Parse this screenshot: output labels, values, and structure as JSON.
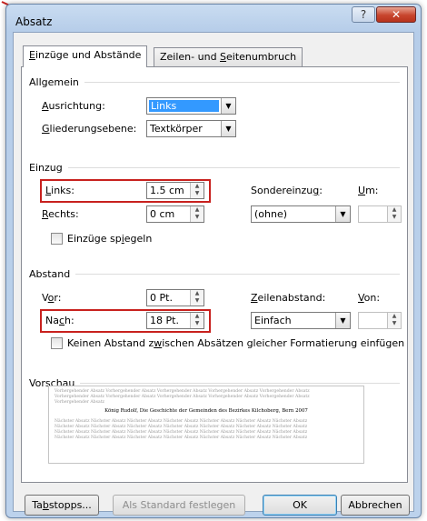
{
  "window": {
    "title": "Absatz",
    "help_label": "?",
    "close_label": "✕"
  },
  "tabs": [
    {
      "label_pre": "",
      "label_u": "E",
      "label_post": "inzüge und Abstände"
    },
    {
      "label_pre": "Zeilen- und ",
      "label_u": "S",
      "label_post": "eitenumbruch"
    }
  ],
  "general": {
    "title": "Allgemein",
    "alignment_label_u": "A",
    "alignment_label_rest": "usrichtung:",
    "alignment_value": "Links",
    "outline_label_u": "G",
    "outline_label_rest": "liederungsebene:",
    "outline_value": "Textkörper"
  },
  "indent": {
    "title": "Einzug",
    "left_label_u": "L",
    "left_label_rest": "inks:",
    "left_value": "1.5 cm",
    "right_label_u": "R",
    "right_label_rest": "echts:",
    "right_value": "0 cm",
    "special_label_pre": "Sondereinzu",
    "special_label_u": "g",
    "special_label_post": ":",
    "special_value": "(ohne)",
    "by_label_u": "U",
    "by_label_rest": "m:",
    "by_value": "",
    "mirror_pre": "Einzüge sp",
    "mirror_u": "i",
    "mirror_post": "egeln"
  },
  "spacing": {
    "title": "Abstand",
    "before_pre": "V",
    "before_u": "o",
    "before_post": "r:",
    "before_value": "0 Pt.",
    "after_pre": "Na",
    "after_u": "c",
    "after_post": "h:",
    "after_value": "18 Pt.",
    "line_label_u": "Z",
    "line_label_rest": "eilenabstand:",
    "line_value": "Einfach",
    "at_label_u": "V",
    "at_label_rest": "on:",
    "at_value": "",
    "noadd_pre": "Keinen Abstand z",
    "noadd_u": "w",
    "noadd_post": "ischen Absätzen gleicher Formatierung einfügen"
  },
  "preview": {
    "title": "Vorschau",
    "prev_text": "Vorhergehender Absatz Vorhergehender Absatz Vorhergehender Absatz Vorhergehender Absatz Vorhergehender Absatz\nVorhergehender Absatz Vorhergehender Absatz Vorhergehender Absatz Vorhergehender Absatz Vorhergehender Absatz\nVorhergehender Absatz",
    "main_text": "König Rudolf, Die Geschichte der Gemeinden des Bezirkes Kilchoberg, Bern 2007",
    "next_text": "Nächster Absatz Nächster Absatz Nächster Absatz Nächster Absatz Nächster Absatz Nächster Absatz Nächster Absatz\nNächster Absatz Nächster Absatz Nächster Absatz Nächster Absatz Nächster Absatz Nächster Absatz Nächster Absatz\nNächster Absatz Nächster Absatz Nächster Absatz Nächster Absatz Nächster Absatz Nächster Absatz Nächster Absatz\nNächster Absatz Nächster Absatz Nächster Absatz Nächster Absatz Nächster Absatz Nächster Absatz Nächster Absatz"
  },
  "buttons": {
    "tabs_pre": "Ta",
    "tabs_u": "b",
    "tabs_post": "stopps...",
    "default_label": "Als Standard festlegen",
    "ok_label": "OK",
    "cancel_label": "Abbrechen"
  },
  "colors": {
    "highlight": "#c8211e",
    "selection": "#3399ff"
  }
}
